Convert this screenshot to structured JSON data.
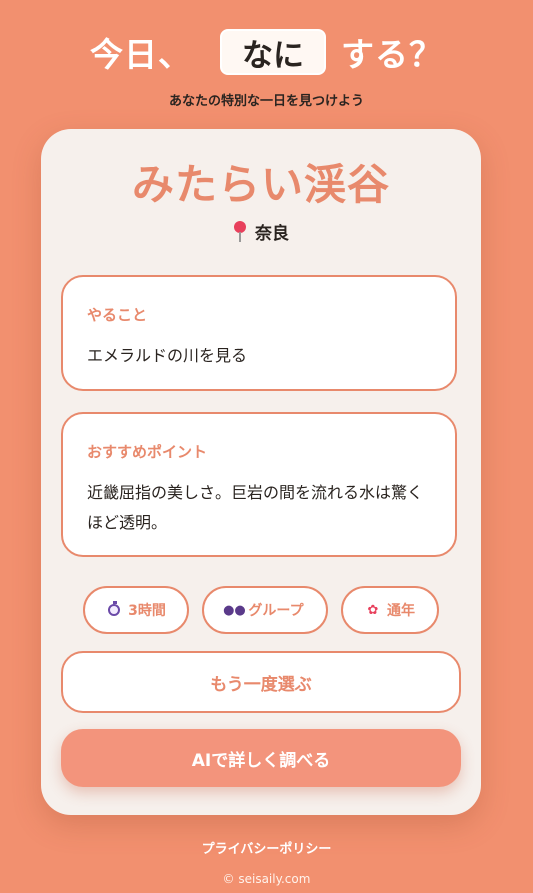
{
  "header": {
    "title_prefix": "今日、",
    "title_highlight": "なに",
    "title_suffix": "する？",
    "subtitle": "あなたの特別な一日を見つけよう"
  },
  "spot": {
    "name": "みたらい渓谷",
    "location": "奈良",
    "todo_label": "やること",
    "todo_text": "エメラルドの川を見る",
    "point_label": "おすすめポイント",
    "point_text": "近畿屈指の美しさ。巨岩の間を流れる水は驚くほど透明。"
  },
  "tags": {
    "duration": "3時間",
    "group": "グループ",
    "season": "通年"
  },
  "buttons": {
    "retry": "もう一度選ぶ",
    "ai": "AIで詳しく調べる"
  },
  "footer": {
    "privacy": "プライバシーポリシー",
    "copyright": "© seisaily.com"
  },
  "colors": {
    "background": "#f2906f",
    "accent": "#e8896c",
    "card": "#f6f0ec"
  }
}
